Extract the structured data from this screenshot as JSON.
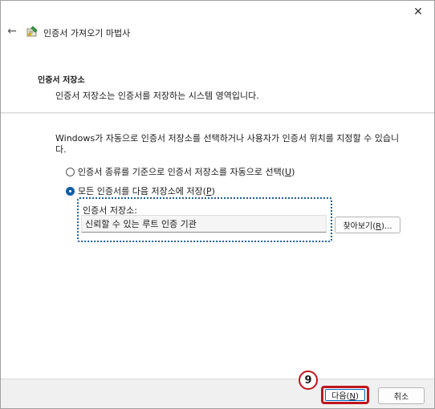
{
  "window": {
    "title": "인증서 가져오기 마법사",
    "close_glyph": "✕",
    "back_glyph": "←"
  },
  "header": {
    "heading": "인증서 저장소",
    "description": "인증서 저장소는 인증서를 저장하는 시스템 영역입니다."
  },
  "body": {
    "instruction": "Windows가 자동으로 인증서 저장소를 선택하거나 사용자가 인증서 위치를 지정할 수 있습니다.",
    "option_auto": {
      "label": "인증서 종류를 기준으로 인증서 저장소를 자동으로 선택(",
      "key": "U",
      "suffix": ")",
      "selected": false
    },
    "option_manual": {
      "label": "모든 인증서를 다음 저장소에 저장(",
      "key": "P",
      "suffix": ")",
      "selected": true
    },
    "store_label": "인증서 저장소:",
    "store_value": "신뢰할 수 있는 루트 인증 기관",
    "browse": {
      "label": "찾아보기(",
      "key": "R",
      "suffix": ")..."
    }
  },
  "footer": {
    "next": {
      "label": "다음(",
      "key": "N",
      "suffix": ")"
    },
    "cancel_label": "취소"
  },
  "annotation": {
    "step_number": "9",
    "color": "#c0161c"
  },
  "colors": {
    "accent": "#0f5da8",
    "focus_dots": "#1f5c9e"
  }
}
